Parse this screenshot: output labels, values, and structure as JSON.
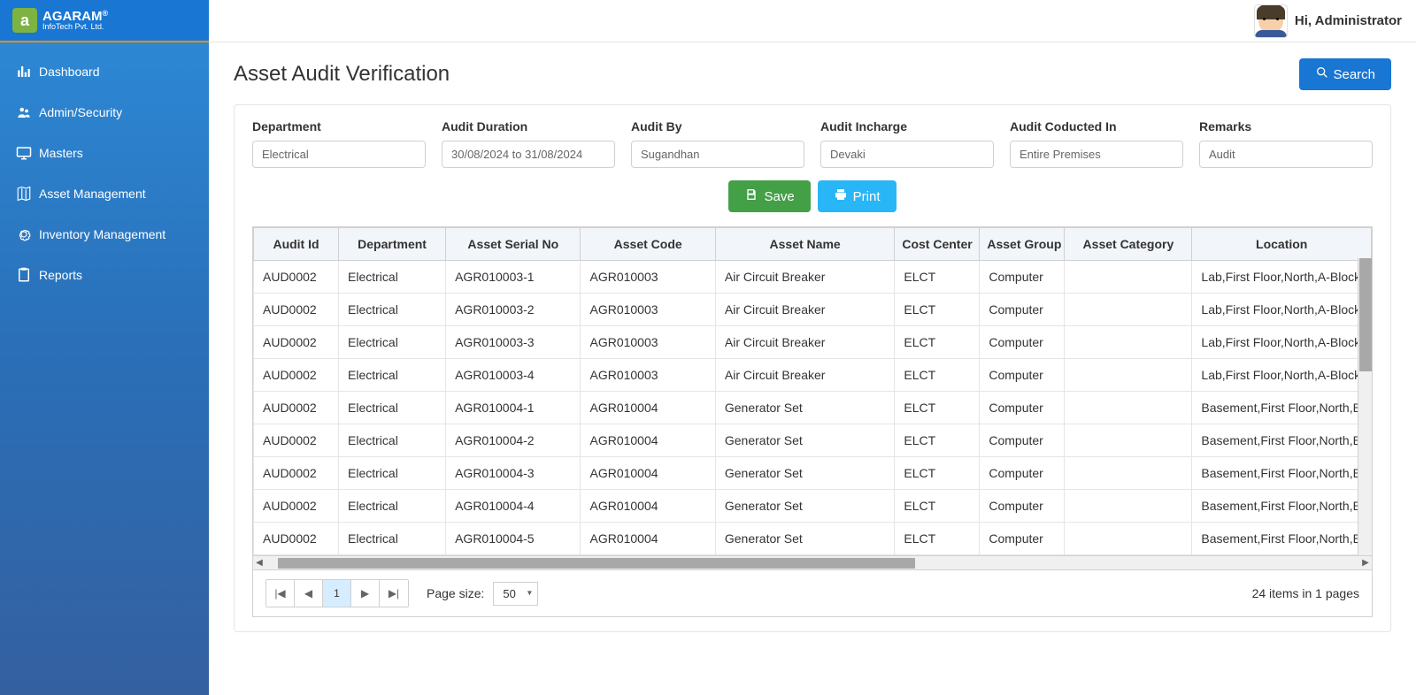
{
  "brand": {
    "name": "AGARAM",
    "sub": "InfoTech Pvt. Ltd.",
    "reg": "®",
    "logo_letter": "a"
  },
  "user": {
    "greeting": "Hi, Administrator"
  },
  "sidebar": {
    "items": [
      {
        "label": "Dashboard",
        "icon": "bar-chart-icon"
      },
      {
        "label": "Admin/Security",
        "icon": "users-icon"
      },
      {
        "label": "Masters",
        "icon": "monitor-icon"
      },
      {
        "label": "Asset Management",
        "icon": "map-icon"
      },
      {
        "label": "Inventory Management",
        "icon": "gear-icon"
      },
      {
        "label": "Reports",
        "icon": "clipboard-icon"
      }
    ]
  },
  "page": {
    "title": "Asset Audit Verification",
    "search_label": "Search"
  },
  "form": {
    "fields": [
      {
        "label": "Department",
        "value": "Electrical"
      },
      {
        "label": "Audit Duration",
        "value": "30/08/2024 to 31/08/2024"
      },
      {
        "label": "Audit By",
        "value": "Sugandhan"
      },
      {
        "label": "Audit Incharge",
        "value": "Devaki"
      },
      {
        "label": "Audit Coducted In",
        "value": "Entire Premises"
      },
      {
        "label": "Remarks",
        "value": "Audit"
      }
    ]
  },
  "actions": {
    "save": "Save",
    "print": "Print"
  },
  "grid": {
    "columns": [
      "Audit Id",
      "Department",
      "Asset Serial No",
      "Asset Code",
      "Asset Name",
      "Cost Center",
      "Asset Group",
      "Asset Category",
      "Location"
    ],
    "rows": [
      {
        "audit_id": "AUD0002",
        "department": "Electrical",
        "serial": "AGR010003-1",
        "asset_code": "AGR010003",
        "asset_name": "Air Circuit Breaker",
        "cost_center": "ELCT",
        "asset_group": "Computer",
        "asset_category": "",
        "location": "Lab,First Floor,North,A-Block,Server Room"
      },
      {
        "audit_id": "AUD0002",
        "department": "Electrical",
        "serial": "AGR010003-2",
        "asset_code": "AGR010003",
        "asset_name": "Air Circuit Breaker",
        "cost_center": "ELCT",
        "asset_group": "Computer",
        "asset_category": "",
        "location": "Lab,First Floor,North,A-Block,Server Room"
      },
      {
        "audit_id": "AUD0002",
        "department": "Electrical",
        "serial": "AGR010003-3",
        "asset_code": "AGR010003",
        "asset_name": "Air Circuit Breaker",
        "cost_center": "ELCT",
        "asset_group": "Computer",
        "asset_category": "",
        "location": "Lab,First Floor,North,A-Block,Server Room"
      },
      {
        "audit_id": "AUD0002",
        "department": "Electrical",
        "serial": "AGR010003-4",
        "asset_code": "AGR010003",
        "asset_name": "Air Circuit Breaker",
        "cost_center": "ELCT",
        "asset_group": "Computer",
        "asset_category": "",
        "location": "Lab,First Floor,North,A-Block,Server Room"
      },
      {
        "audit_id": "AUD0002",
        "department": "Electrical",
        "serial": "AGR010004-1",
        "asset_code": "AGR010004",
        "asset_name": "Generator Set",
        "cost_center": "ELCT",
        "asset_group": "Computer",
        "asset_category": "",
        "location": "Basement,First Floor,North,B-Block"
      },
      {
        "audit_id": "AUD0002",
        "department": "Electrical",
        "serial": "AGR010004-2",
        "asset_code": "AGR010004",
        "asset_name": "Generator Set",
        "cost_center": "ELCT",
        "asset_group": "Computer",
        "asset_category": "",
        "location": "Basement,First Floor,North,B-Block"
      },
      {
        "audit_id": "AUD0002",
        "department": "Electrical",
        "serial": "AGR010004-3",
        "asset_code": "AGR010004",
        "asset_name": "Generator Set",
        "cost_center": "ELCT",
        "asset_group": "Computer",
        "asset_category": "",
        "location": "Basement,First Floor,North,B-Block"
      },
      {
        "audit_id": "AUD0002",
        "department": "Electrical",
        "serial": "AGR010004-4",
        "asset_code": "AGR010004",
        "asset_name": "Generator Set",
        "cost_center": "ELCT",
        "asset_group": "Computer",
        "asset_category": "",
        "location": "Basement,First Floor,North,B-Block"
      },
      {
        "audit_id": "AUD0002",
        "department": "Electrical",
        "serial": "AGR010004-5",
        "asset_code": "AGR010004",
        "asset_name": "Generator Set",
        "cost_center": "ELCT",
        "asset_group": "Computer",
        "asset_category": "",
        "location": "Basement,First Floor,North,B-Block"
      }
    ]
  },
  "pager": {
    "page_size_label": "Page size:",
    "page_size_value": "50",
    "current_page": "1",
    "info": "24 items in 1 pages",
    "first": "|◀",
    "prev": "◀",
    "next": "▶",
    "last": "▶|"
  }
}
